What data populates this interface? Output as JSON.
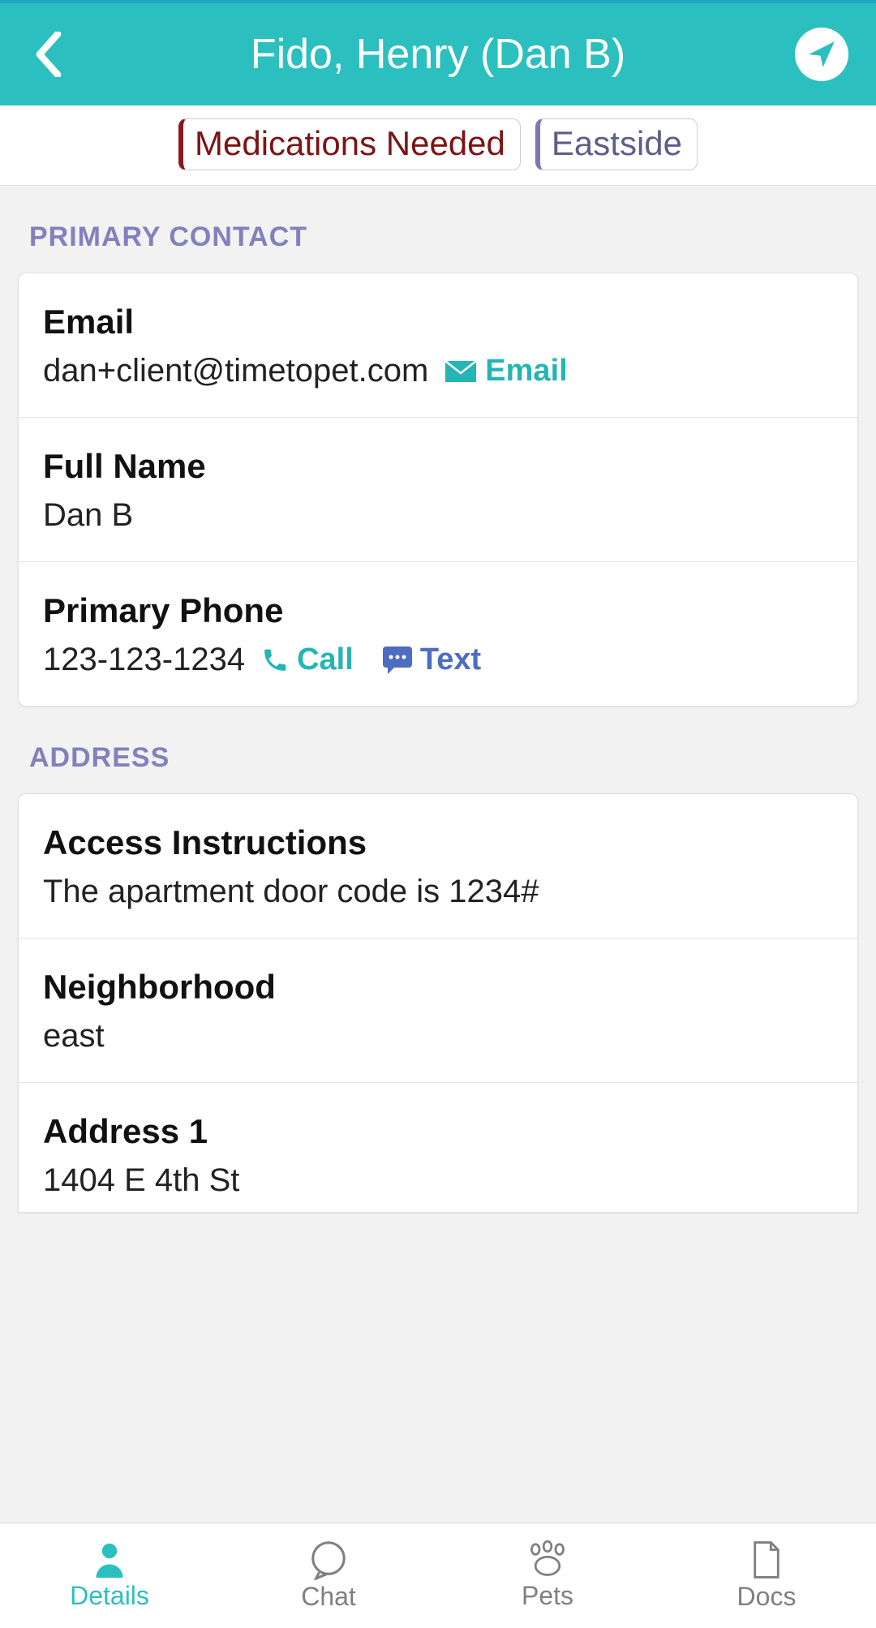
{
  "header": {
    "title": "Fido, Henry (Dan B)"
  },
  "tags": {
    "medications": "Medications Needed",
    "region": "Eastside"
  },
  "sections": {
    "primary_contact_header": "PRIMARY CONTACT",
    "address_header": "ADDRESS"
  },
  "contact": {
    "email_label": "Email",
    "email_value": "dan+client@timetopet.com",
    "email_action": "Email",
    "name_label": "Full Name",
    "name_value": "Dan B",
    "phone_label": "Primary Phone",
    "phone_value": "123-123-1234",
    "call_action": "Call",
    "text_action": "Text"
  },
  "address": {
    "access_label": "Access Instructions",
    "access_value": "The apartment door code is 1234#",
    "neighborhood_label": "Neighborhood",
    "neighborhood_value": "east",
    "address1_label": "Address 1",
    "address1_value": "1404 E 4th St"
  },
  "tabs": {
    "details": "Details",
    "chat": "Chat",
    "pets": "Pets",
    "docs": "Docs"
  }
}
